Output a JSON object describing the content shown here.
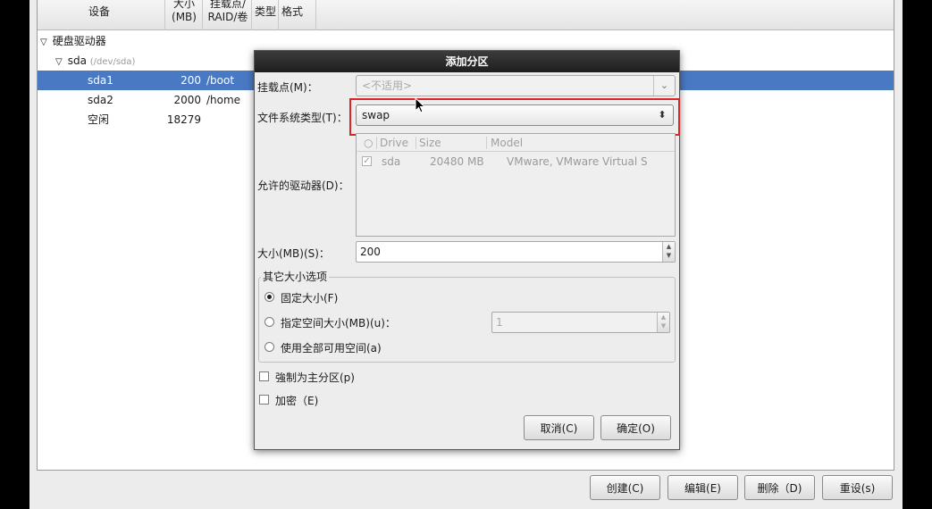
{
  "tree": {
    "columns": {
      "device": "设备",
      "size_line1": "大小",
      "size_line2": "(MB)",
      "mount_line1": "挂载点/",
      "mount_line2": "RAID/卷",
      "type": "类型",
      "format": "格式"
    },
    "group_label": "硬盘驱动器",
    "disk": {
      "name": "sda",
      "path": "(/dev/sda)"
    },
    "rows": [
      {
        "device": "sda1",
        "size": "200",
        "mount": "/boot"
      },
      {
        "device": "sda2",
        "size": "2000",
        "mount": "/home"
      },
      {
        "device": "空闲",
        "size": "18279",
        "mount": ""
      }
    ]
  },
  "bottom_buttons": {
    "create": "创建(C)",
    "edit": "编辑(E)",
    "delete": "删除（D)",
    "reset": "重设(s)"
  },
  "dialog": {
    "title": "添加分区",
    "mount_label": "挂载点(M)：",
    "mount_value": "<不适用>",
    "fs_label": "文件系统类型(T)：",
    "fs_value": "swap",
    "drives_label": "允许的驱动器(D)：",
    "drives_columns": {
      "drive": "Drive",
      "size": "Size",
      "model": "Model"
    },
    "drive_row": {
      "drive": "sda",
      "size": "20480 MB",
      "model": "VMware, VMware Virtual S"
    },
    "size_label": "大小(MB)(S)：",
    "size_value": "200",
    "other_size_legend": "其它大小选项",
    "opt_fixed": "固定大小(F)",
    "opt_fill_to": "指定空间大小(MB)(u)：",
    "fill_to_value": "1",
    "opt_fill_all": "使用全部可用空间(a)",
    "force_primary": "強制为主分区(p)",
    "encrypt": "加密（E)",
    "cancel": "取消(C)",
    "ok": "确定(O)"
  },
  "colors": {
    "selection": "#4a79c4",
    "highlight_border": "#d9252a",
    "title_bar": "#2a2a2a"
  }
}
